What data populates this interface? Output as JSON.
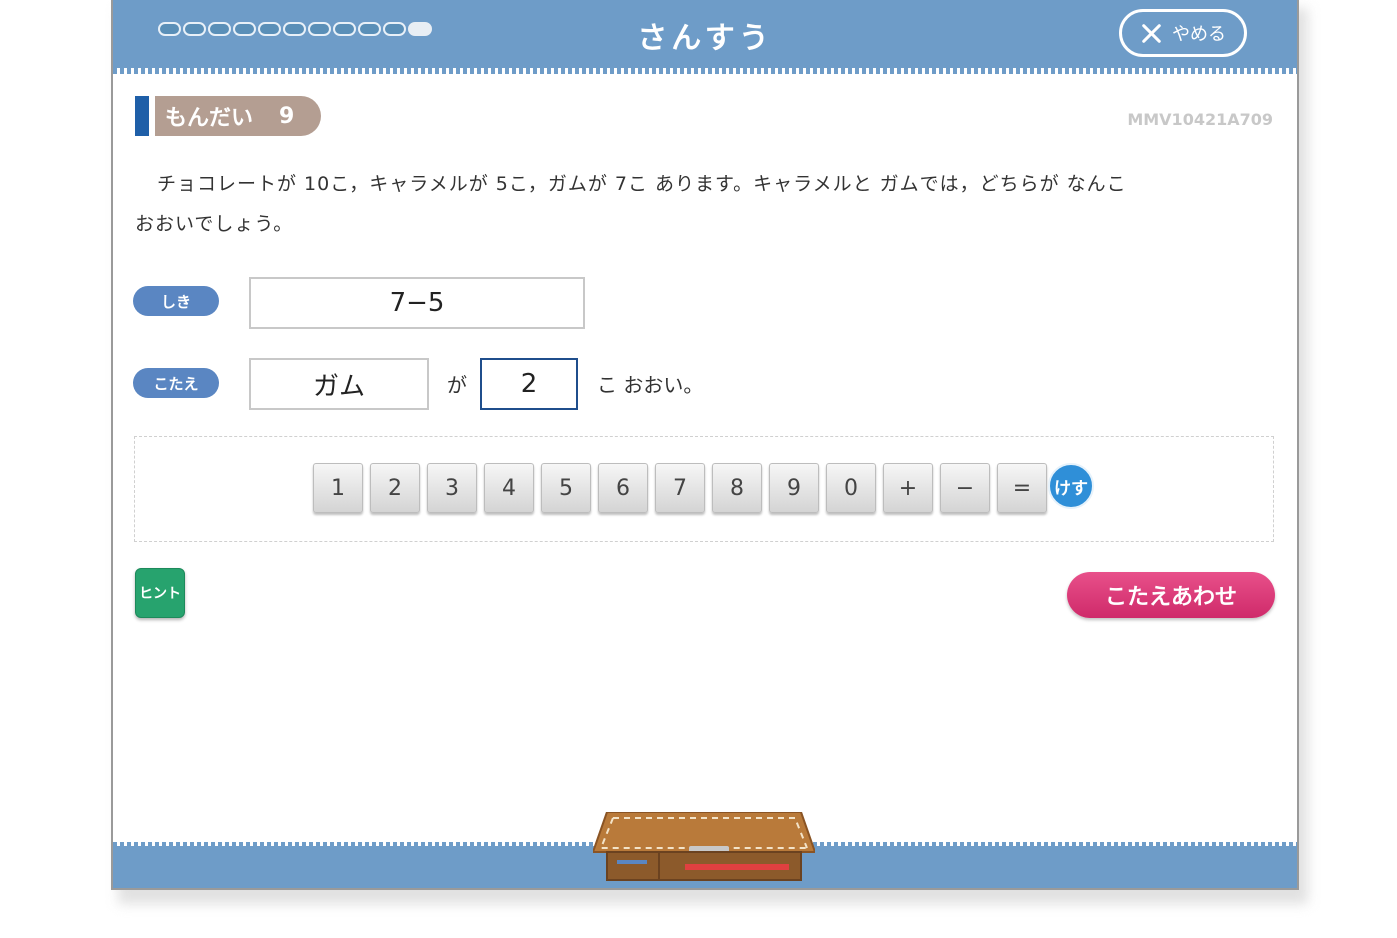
{
  "header": {
    "title": "さんすう",
    "quit_label": "やめる",
    "progress": {
      "total": 11,
      "current": 11
    }
  },
  "problem": {
    "label": "もんだい",
    "number": "9",
    "code": "MMV10421A709",
    "text_line1": "チョコレートが 10こ，キャラメルが 5こ，ガムが 7こ あります。キャラメルと ガムでは，どちらが なんこ",
    "text_line2": "おおいでしょう。"
  },
  "formula": {
    "tag": "しき",
    "value": "7−5"
  },
  "answer": {
    "tag": "こたえ",
    "which_value": "ガム",
    "particle": "が",
    "count_value": "2",
    "suffix": "こ おおい。"
  },
  "keypad": {
    "keys": [
      "1",
      "2",
      "3",
      "4",
      "5",
      "6",
      "7",
      "8",
      "9",
      "0",
      "+",
      "−",
      "="
    ],
    "erase_label": "けす"
  },
  "hint_label": "ヒント",
  "check_label": "こたえあわせ",
  "colors": {
    "header": "#6e9cc8",
    "tag": "#5a86c2",
    "check_button": "#d93a77",
    "hint_button": "#27a36e",
    "erase_button": "#2f8fd8"
  }
}
